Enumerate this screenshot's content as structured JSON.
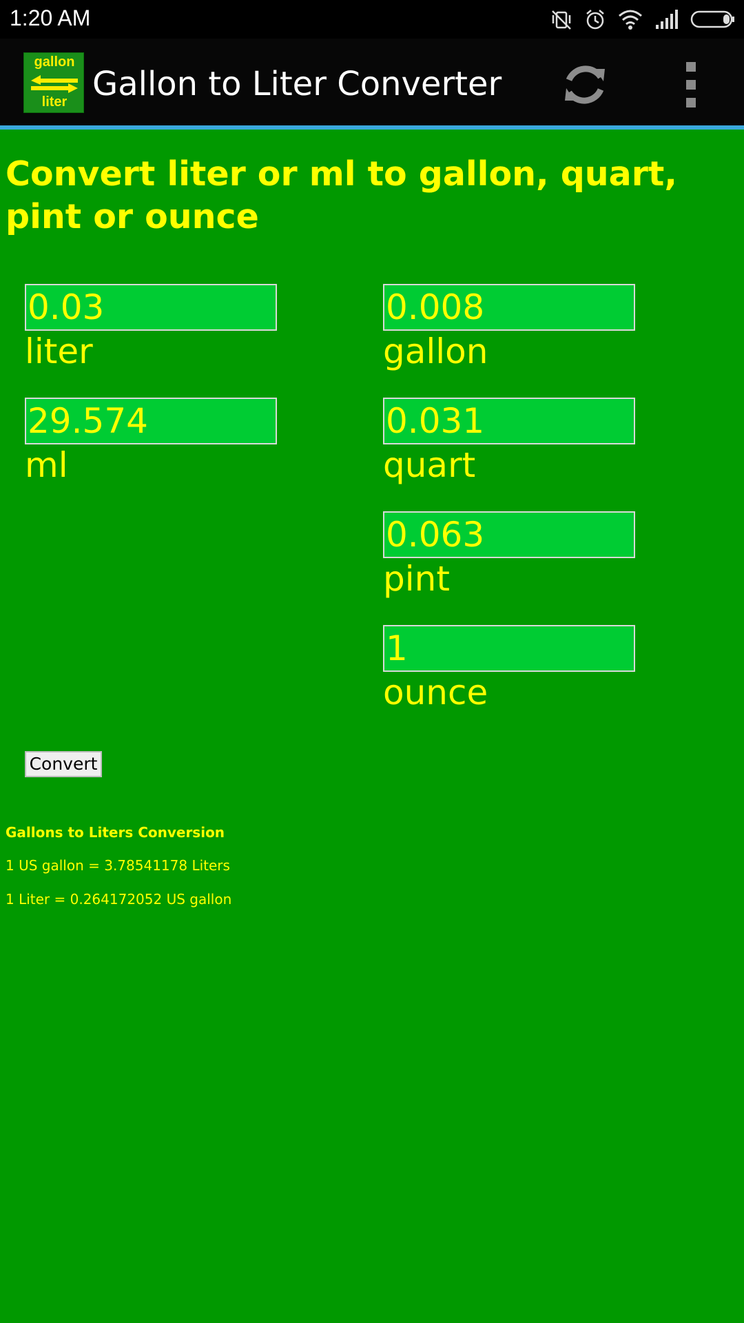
{
  "status_bar": {
    "time": "1:20 AM",
    "icons": [
      "vibrate-off-icon",
      "alarm-icon",
      "wifi-icon",
      "signal-icon",
      "battery-icon"
    ]
  },
  "app_bar": {
    "logo_top": "gallon",
    "logo_bottom": "liter",
    "title": "Gallon to Liter Converter",
    "actions": [
      "refresh-icon",
      "overflow-menu-icon"
    ],
    "accent_line_color": "#3aa8dc"
  },
  "heading": "Convert liter or ml to gallon, quart, pint or ounce",
  "fields": {
    "liter": {
      "value": "0.03",
      "label": "liter"
    },
    "ml": {
      "value": "29.574",
      "label": "ml"
    },
    "gallon": {
      "value": "0.008",
      "label": "gallon"
    },
    "quart": {
      "value": "0.031",
      "label": "quart"
    },
    "pint": {
      "value": "0.063",
      "label": "pint"
    },
    "ounce": {
      "value": "1",
      "label": "ounce"
    }
  },
  "convert_button": "Convert",
  "info": {
    "title": "Gallons to Liters Conversion",
    "line1": "1 US gallon = 3.78541178 Liters",
    "line2": "1 Liter = 0.264172052 US gallon"
  },
  "colors": {
    "background": "#019900",
    "text": "#ffff00",
    "field_background": "#00cc33"
  }
}
